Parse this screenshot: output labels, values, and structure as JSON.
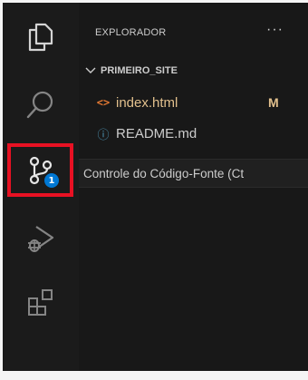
{
  "explorer": {
    "title": "EXPLORADOR",
    "more_label": "···",
    "folder": {
      "name": "PRIMEIRO_SITE",
      "expanded": true
    },
    "files": [
      {
        "icon": "html-file-icon",
        "glyph": "<>",
        "name": "index.html",
        "status": "M",
        "color": "#e2c08d"
      },
      {
        "icon": "info-icon",
        "glyph": "ⓘ",
        "name": "README.md",
        "status": "",
        "color": "#cccccc"
      }
    ]
  },
  "activity_bar": {
    "items": [
      {
        "name": "explorer",
        "icon": "files-icon"
      },
      {
        "name": "search",
        "icon": "search-icon"
      },
      {
        "name": "source-control",
        "icon": "source-control-icon",
        "badge": "1",
        "highlighted": true
      },
      {
        "name": "run-and-debug",
        "icon": "run-debug-icon"
      },
      {
        "name": "extensions",
        "icon": "extensions-icon"
      }
    ]
  },
  "tooltip": {
    "text": "Controle do Código-Fonte (Ct"
  },
  "colors": {
    "highlight_border": "#e81123",
    "badge_bg": "#0078d4",
    "modified": "#e2c08d",
    "html_icon": "#e37933",
    "info_icon": "#519aba"
  }
}
